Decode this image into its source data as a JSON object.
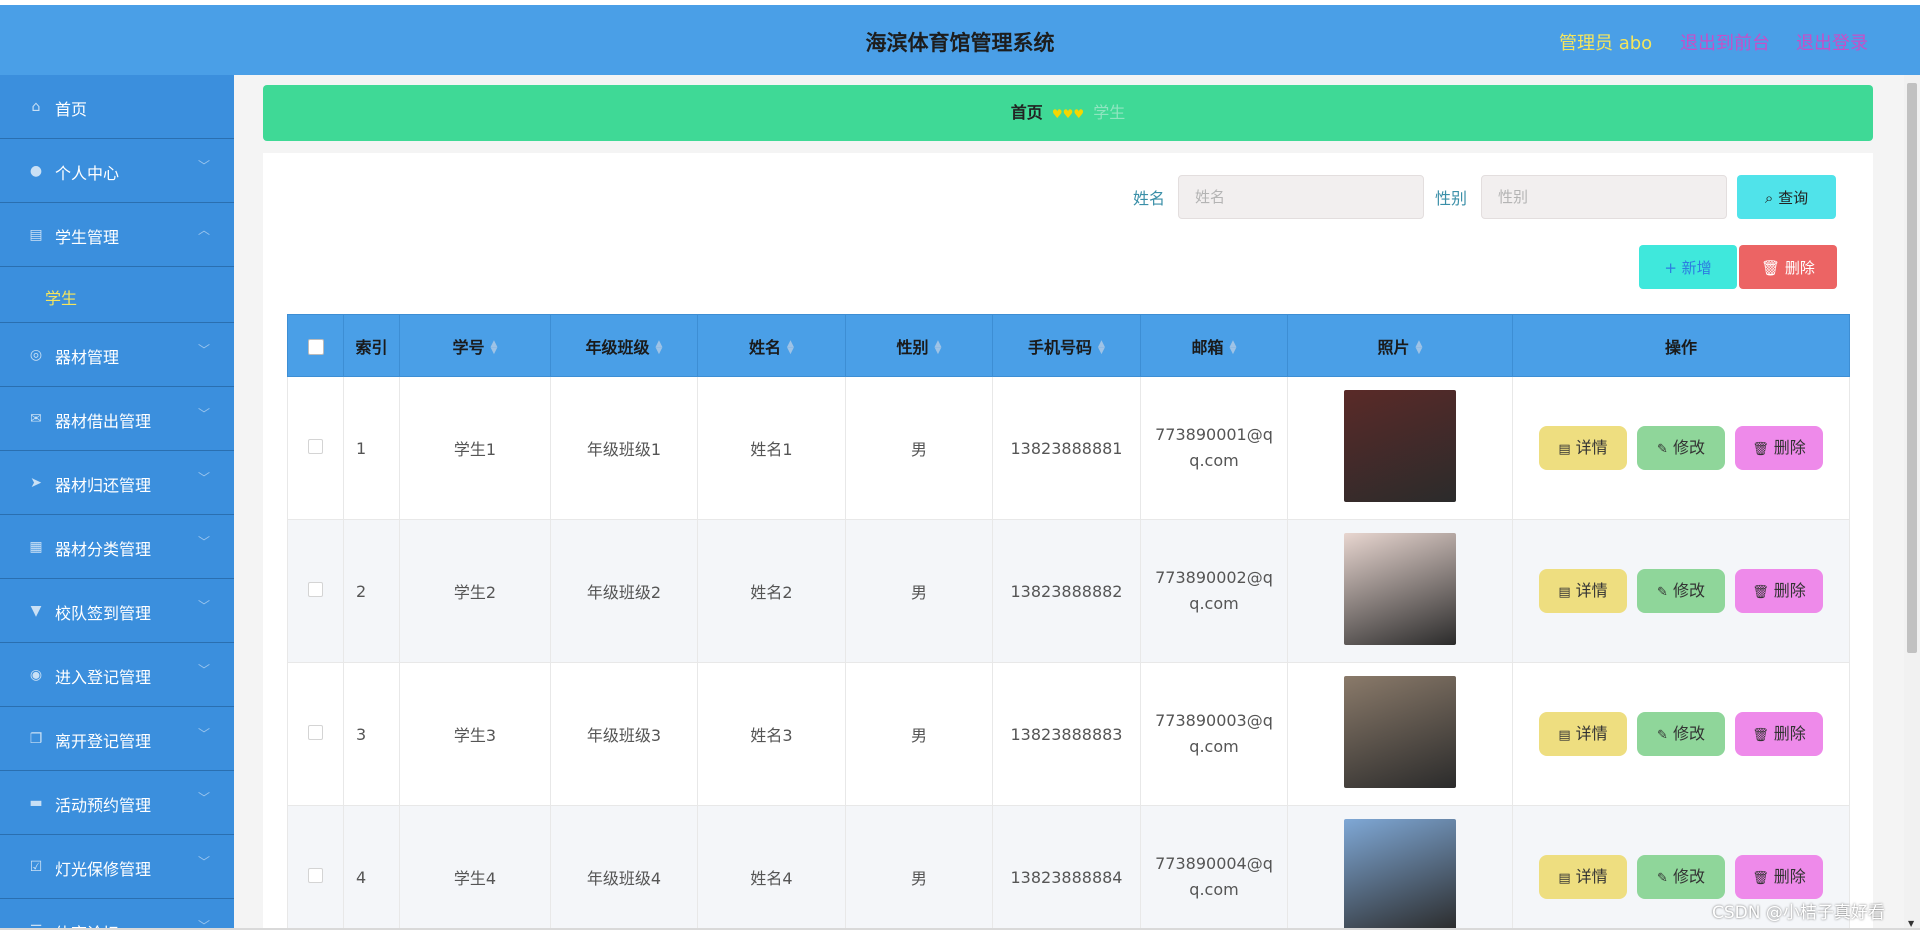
{
  "header": {
    "title": "海滨体育馆管理系统",
    "admin_label": "管理员 abo",
    "front_link": "退出到前台",
    "logout_link": "退出登录"
  },
  "sidebar": {
    "items": [
      {
        "label": "首页",
        "icon": "home-icon",
        "glyph": "⌂",
        "expandable": false
      },
      {
        "label": "个人中心",
        "icon": "user-icon",
        "glyph": "●",
        "expandable": true
      },
      {
        "label": "学生管理",
        "icon": "clipboard-icon",
        "glyph": "▤",
        "expandable": true,
        "expanded": true
      },
      {
        "label": "器材管理",
        "icon": "compass-icon",
        "glyph": "◎",
        "expandable": true
      },
      {
        "label": "器材借出管理",
        "icon": "mail-icon",
        "glyph": "✉",
        "expandable": true
      },
      {
        "label": "器材归还管理",
        "icon": "send-icon",
        "glyph": "➤",
        "expandable": true
      },
      {
        "label": "器材分类管理",
        "icon": "grid-icon",
        "glyph": "▦",
        "expandable": true
      },
      {
        "label": "校队签到管理",
        "icon": "stamp-icon",
        "glyph": "▼",
        "expandable": true
      },
      {
        "label": "进入登记管理",
        "icon": "circle-icon",
        "glyph": "◉",
        "expandable": true
      },
      {
        "label": "离开登记管理",
        "icon": "copy-icon",
        "glyph": "❐",
        "expandable": true
      },
      {
        "label": "活动预约管理",
        "icon": "monitor-icon",
        "glyph": "▬",
        "expandable": true
      },
      {
        "label": "灯光保修管理",
        "icon": "check-square-icon",
        "glyph": "☑",
        "expandable": true
      },
      {
        "label": "体育论坛",
        "icon": "menu-icon",
        "glyph": "☰",
        "expandable": true
      }
    ],
    "sub_item": "学生"
  },
  "breadcrumb": {
    "home": "首页",
    "separator": "♥♥♥",
    "current": "学生"
  },
  "search": {
    "name_label": "姓名",
    "name_placeholder": "姓名",
    "gender_label": "性别",
    "gender_placeholder": "性别",
    "query_button": "查询"
  },
  "actions": {
    "add_button": "新增",
    "delete_button": "删除"
  },
  "table": {
    "columns": [
      "索引",
      "学号",
      "年级班级",
      "姓名",
      "性别",
      "手机号码",
      "邮箱",
      "照片",
      "操作"
    ],
    "rows": [
      {
        "index": "1",
        "student_no": "学生1",
        "class": "年级班级1",
        "name": "姓名1",
        "gender": "男",
        "phone": "13823888881",
        "email": "773890001@qq.com",
        "photo": "#5a2a28"
      },
      {
        "index": "2",
        "student_no": "学生2",
        "class": "年级班级2",
        "name": "姓名2",
        "gender": "男",
        "phone": "13823888882",
        "email": "773890002@qq.com",
        "photo": "#e8d6d0"
      },
      {
        "index": "3",
        "student_no": "学生3",
        "class": "年级班级3",
        "name": "姓名3",
        "gender": "男",
        "phone": "13823888883",
        "email": "773890003@qq.com",
        "photo": "#8a7a6a"
      },
      {
        "index": "4",
        "student_no": "学生4",
        "class": "年级班级4",
        "name": "姓名4",
        "gender": "男",
        "phone": "13823888884",
        "email": "773890004@qq.com",
        "photo": "#7fa8d6"
      }
    ],
    "row_actions": {
      "detail": "详情",
      "edit": "修改",
      "delete": "删除"
    }
  },
  "watermark": "CSDN @小桔子真好看",
  "colors": {
    "header": "#4a9fe7",
    "sidebar": "#3b8fdd",
    "breadcrumb": "#3fd996",
    "accent_yellow": "#f5e55c",
    "accent_purple": "#c64fc8"
  }
}
